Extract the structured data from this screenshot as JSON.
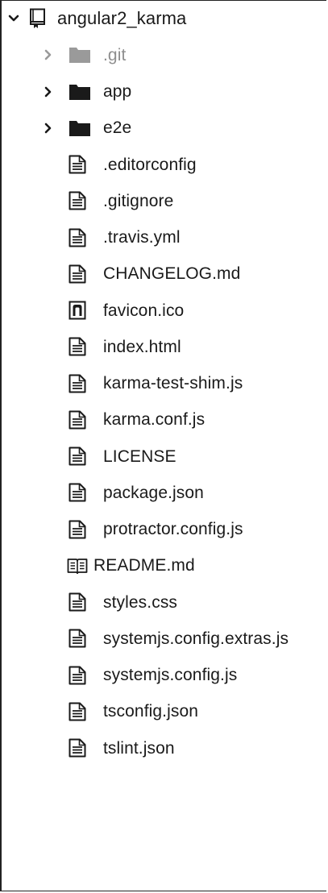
{
  "tree": {
    "root": {
      "label": "angular2_karma",
      "expanded": true,
      "icon": "repo-icon"
    },
    "folders": [
      {
        "label": ".git",
        "expanded": false,
        "muted": true,
        "icon": "folder-icon"
      },
      {
        "label": "app",
        "expanded": false,
        "muted": false,
        "icon": "folder-icon"
      },
      {
        "label": "e2e",
        "expanded": false,
        "muted": false,
        "icon": "folder-icon"
      }
    ],
    "files": [
      {
        "label": ".editorconfig",
        "icon": "file-text-icon"
      },
      {
        "label": ".gitignore",
        "icon": "file-text-icon"
      },
      {
        "label": ".travis.yml",
        "icon": "file-text-icon"
      },
      {
        "label": "CHANGELOG.md",
        "icon": "file-text-icon"
      },
      {
        "label": "favicon.ico",
        "icon": "file-media-icon"
      },
      {
        "label": "index.html",
        "icon": "file-text-icon"
      },
      {
        "label": "karma-test-shim.js",
        "icon": "file-text-icon"
      },
      {
        "label": "karma.conf.js",
        "icon": "file-text-icon"
      },
      {
        "label": "LICENSE",
        "icon": "file-text-icon"
      },
      {
        "label": "package.json",
        "icon": "file-text-icon"
      },
      {
        "label": "protractor.config.js",
        "icon": "file-text-icon"
      },
      {
        "label": "README.md",
        "icon": "book-icon"
      },
      {
        "label": "styles.css",
        "icon": "file-text-icon"
      },
      {
        "label": "systemjs.config.extras.js",
        "icon": "file-text-icon"
      },
      {
        "label": "systemjs.config.js",
        "icon": "file-text-icon"
      },
      {
        "label": "tsconfig.json",
        "icon": "file-text-icon"
      },
      {
        "label": "tslint.json",
        "icon": "file-text-icon"
      }
    ]
  }
}
